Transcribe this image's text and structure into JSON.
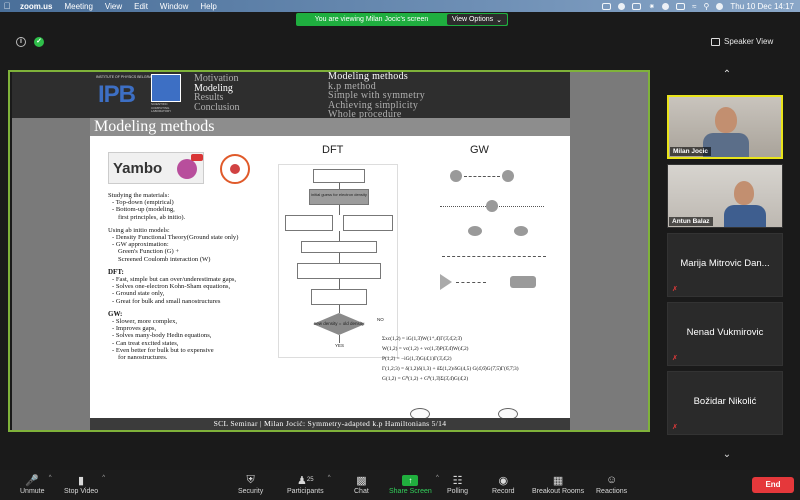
{
  "menubar": {
    "app": "zoom.us",
    "items": [
      "Meeting",
      "View",
      "Edit",
      "Window",
      "Help"
    ],
    "clock": "Thu 10 Dec  14:17"
  },
  "banner": {
    "text": "You are viewing Milan Jocic's screen",
    "view_options": "View Options"
  },
  "view": {
    "speaker_view": "Speaker View"
  },
  "slide": {
    "logo_text": "INSTITUTE OF PHYSICS BELGRADE",
    "logo_ipb": "IPB",
    "logo2_text": "SCIENTIFIC COMPUTING LABORATORY",
    "nav_left": [
      "Motivation",
      "Modeling",
      "Results",
      "Conclusion"
    ],
    "nav_left_active": 1,
    "nav_right": [
      "Modeling methods",
      "k.p method",
      "Simple with symmetry",
      "Achieving simplicity",
      "Whole procedure"
    ],
    "nav_right_active": 0,
    "title": "Modeling methods",
    "yambo": "Yambo",
    "dft_label": "DFT",
    "gw_label": "GW",
    "body": {
      "intro": "Studying the materials:",
      "intro_items": [
        "- Top-down (empirical)",
        "- Bottom-up (modeling,",
        "  first principles, ab initio)."
      ],
      "abinitio": "Using ab initio models:",
      "abinitio_items": [
        "- Density Functional Theory(Ground state only)",
        "- GW approximation:",
        "Green's Function (G) +",
        "Screened Coulomb interaction (W)"
      ],
      "dft_head": "DFT:",
      "dft_items": [
        "- Fast, simple but can over/underestimate gaps,",
        "- Solves one-electron Kohn-Sham equations,",
        "- Ground state only,",
        "- Great for bulk and small nanostructures"
      ],
      "gw_head": "GW:",
      "gw_items": [
        "- Slower, more complex,",
        "- Improves  gaps,",
        "- Solves many-body Hedin equations,",
        "- Can treat excited states,",
        "- Even better for bulk but to expensive",
        "  for nanostructures."
      ]
    },
    "flow": {
      "initial": "initial guess for electron density",
      "check": "new density = old density",
      "no": "NO",
      "yes": "YES"
    },
    "equations": [
      "Σxc(1,2) = iG(1,3̄)W(1⁺,4̄)Γ(3̄,4̄,2;3̄)",
      "W(1,2) = vc(1,2) + vc(1,3̄)P(3̄,4̄)W(4̄,2)",
      "P(1,2) = −iG(1,3̄)G(4̄,1)Γ(3̄,4̄,2)",
      "Γ(1,2;3) = δ(1,2)δ(1,3) + δΣ(1,2)/δG(4,5) G(4̄,6̄)G(7̄,5̄)Γ(6̄,7̄;3)",
      "G(1,2) = G⁰(1,2) + G⁰(1,3̄)Σ(3̄,4̄)G(4̄,2)"
    ],
    "footer": "SCL Seminar   |   Milan Jocić:  Symmetry-adapted k.p Hamiltonians 5/14"
  },
  "participants": [
    {
      "name": "Milan Jocic",
      "video": true,
      "active": true
    },
    {
      "name": "Antun Balaz",
      "video": true,
      "active": false
    },
    {
      "name": "Marija Mitrovic Dan...",
      "video": false,
      "active": false
    },
    {
      "name": "Nenad Vukmirovic",
      "video": false,
      "active": false
    },
    {
      "name": "Božidar Nikolić",
      "video": false,
      "active": false
    }
  ],
  "toolbar": {
    "unmute": "Unmute",
    "stop_video": "Stop Video",
    "security": "Security",
    "participants": "Participants",
    "participants_count": "25",
    "chat": "Chat",
    "share_screen": "Share Screen",
    "polling": "Polling",
    "record": "Record",
    "breakout": "Breakout Rooms",
    "reactions": "Reactions",
    "end": "End"
  },
  "colors": {
    "share_border": "#7fb23a",
    "banner": "#1fae3f",
    "end": "#e5383b",
    "active_speaker": "#e9e41a"
  }
}
